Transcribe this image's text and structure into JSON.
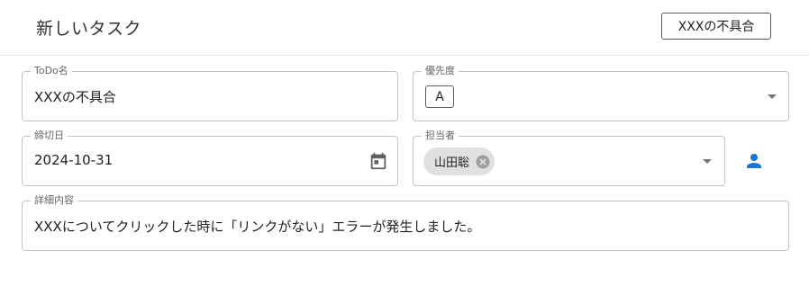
{
  "header": {
    "title": "新しいタスク",
    "chip": "XXXの不具合"
  },
  "form": {
    "todo": {
      "label": "ToDo名",
      "value": "XXXの不具合"
    },
    "priority": {
      "label": "優先度",
      "value": "A"
    },
    "deadline": {
      "label": "締切日",
      "value": "2024-10-31"
    },
    "assignee": {
      "label": "担当者",
      "chip": "山田聡"
    },
    "details": {
      "label": "詳細内容",
      "value": "XXXについてクリックした時に「リンクがない」エラーが発生しました。"
    }
  },
  "colors": {
    "accent": "#1976d2",
    "border": "#c4c4c4",
    "chip_bg": "#e0e0e0"
  },
  "icons": {
    "calendar": "calendar-icon",
    "caret": "arrow-drop-down-icon",
    "chip_delete": "cancel-icon",
    "person": "person-icon"
  }
}
